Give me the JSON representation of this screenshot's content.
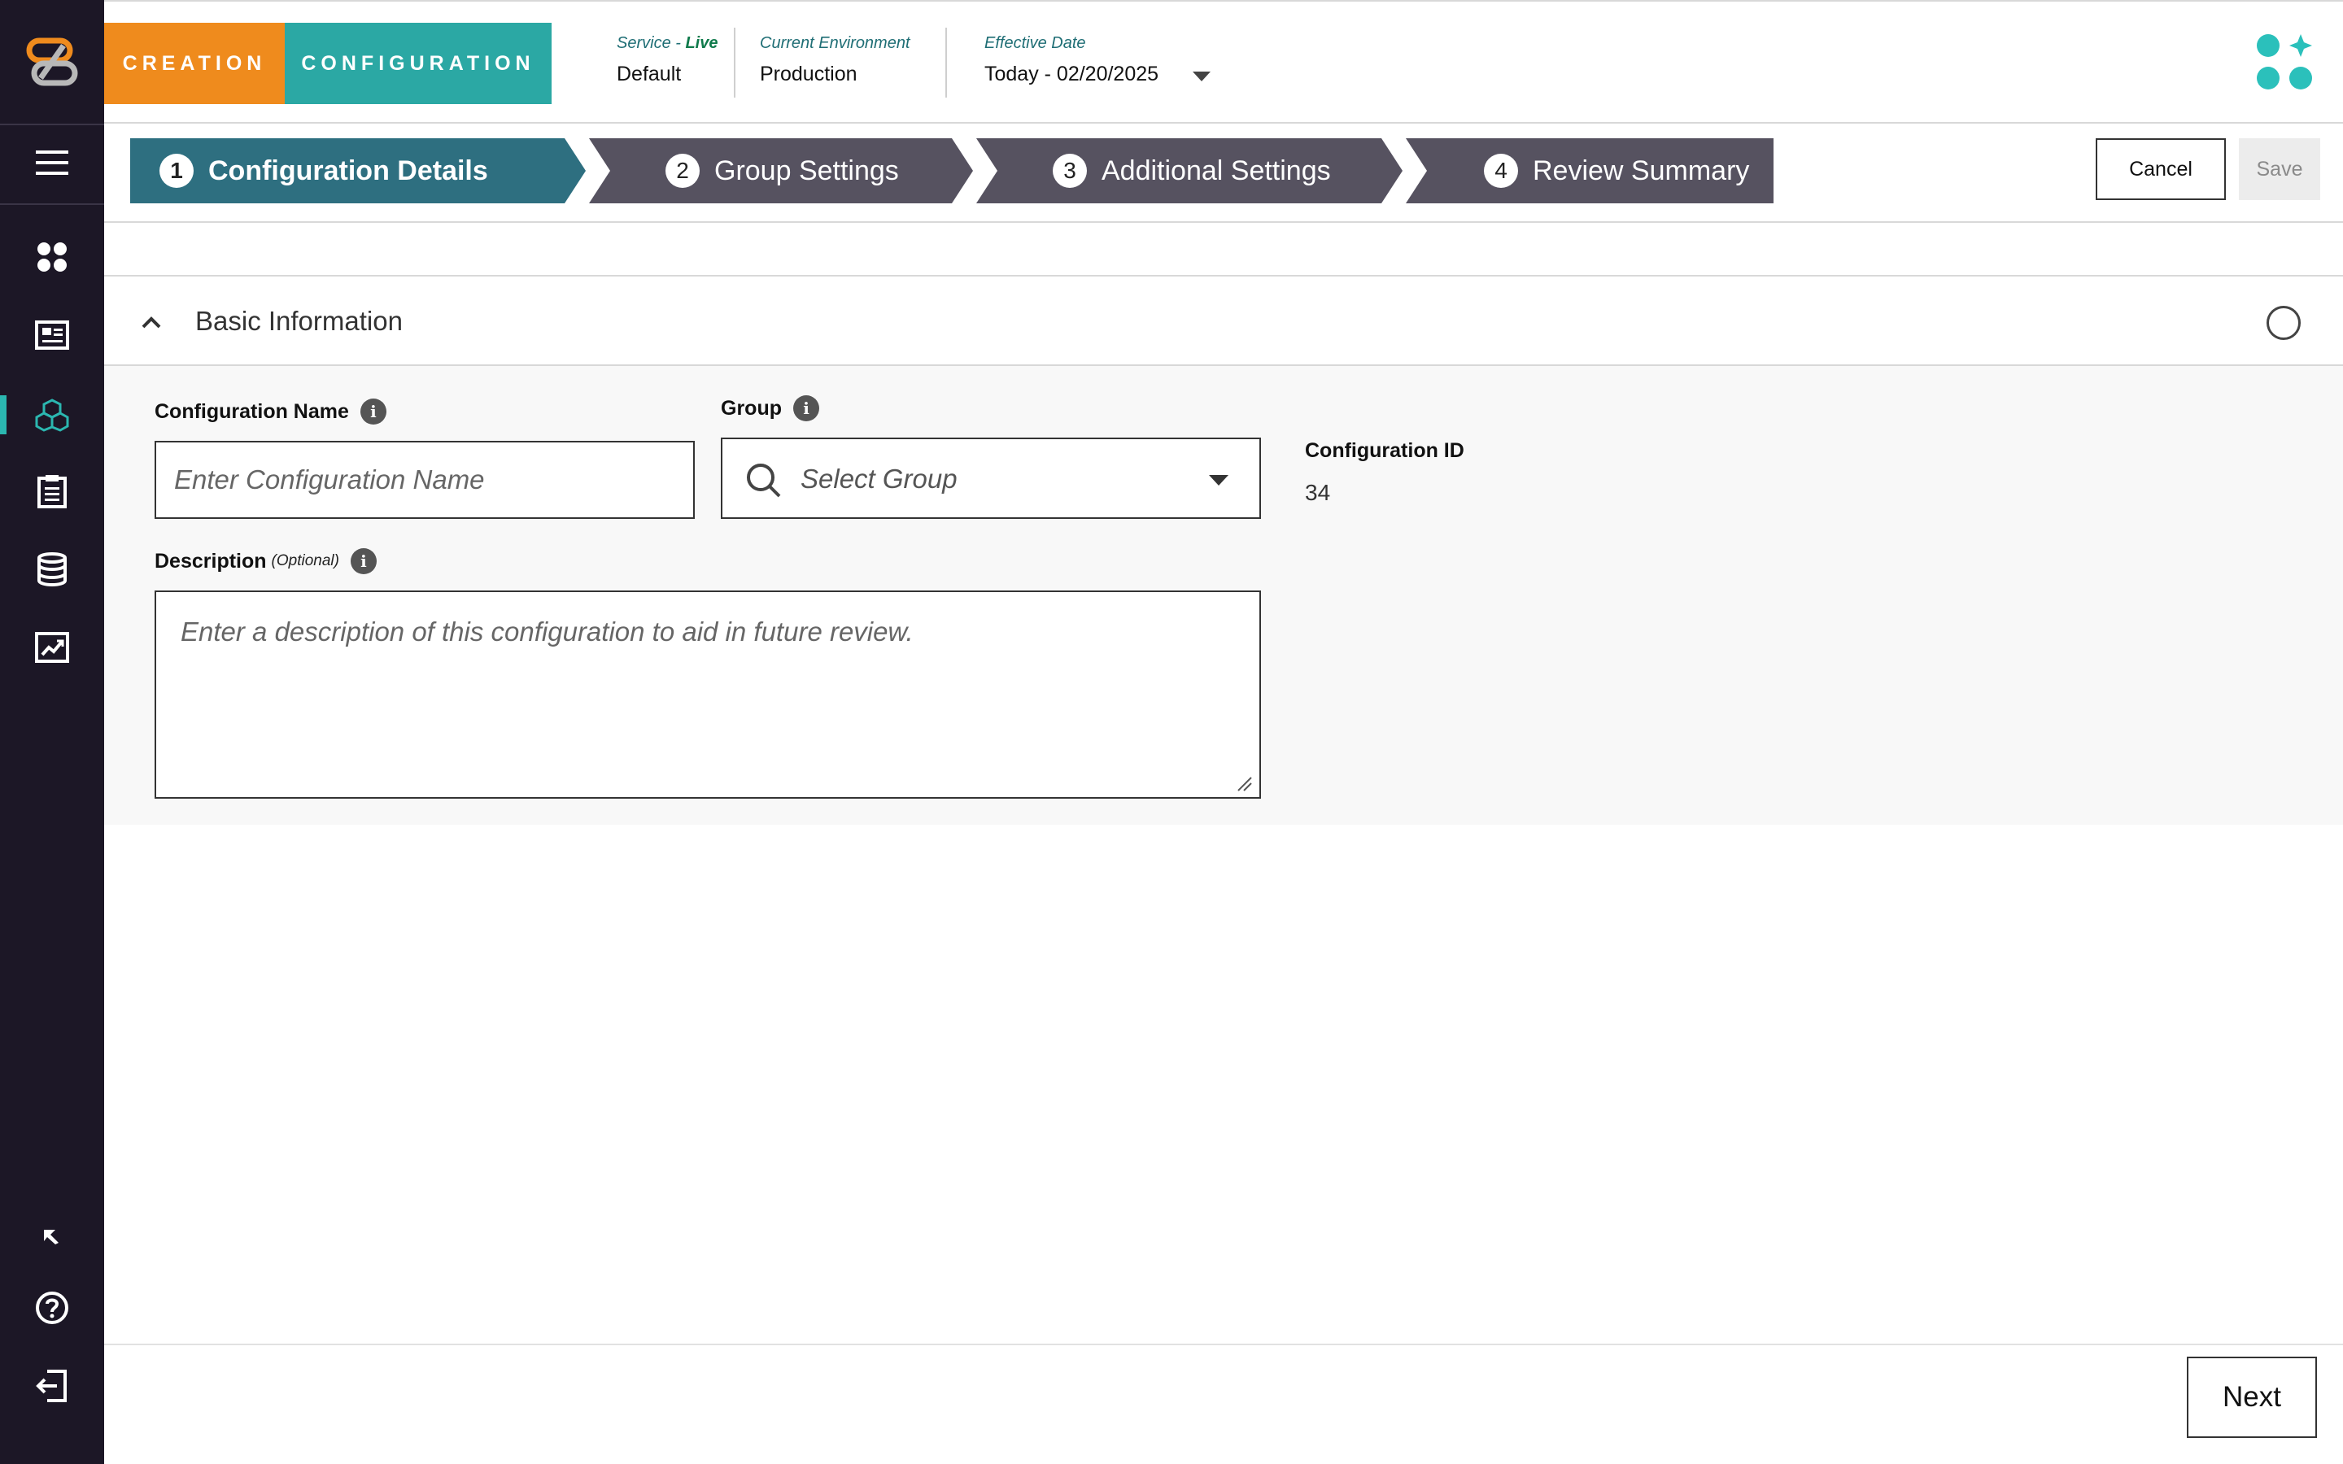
{
  "brand": {
    "creation": "CREATION",
    "configuration": "CONFIGURATION"
  },
  "header": {
    "service_label": "Service - ",
    "service_status": "Live",
    "service_value": "Default",
    "environment_label": "Current Environment",
    "environment_value": "Production",
    "date_label": "Effective Date",
    "date_value": "Today - 02/20/2025"
  },
  "steps": [
    {
      "num": "1",
      "label": "Configuration Details",
      "active": true
    },
    {
      "num": "2",
      "label": "Group Settings",
      "active": false
    },
    {
      "num": "3",
      "label": "Additional Settings",
      "active": false
    },
    {
      "num": "4",
      "label": "Review Summary",
      "active": false
    }
  ],
  "actions": {
    "cancel": "Cancel",
    "save": "Save",
    "next": "Next"
  },
  "section": {
    "title": "Basic Information"
  },
  "form": {
    "config_name_label": "Configuration Name",
    "config_name_placeholder": "Enter Configuration Name",
    "group_label": "Group",
    "group_placeholder": "Select Group",
    "description_label": "Description",
    "description_optional": "(Optional)",
    "description_placeholder": "Enter a description of this configuration to aid in future review.",
    "config_id_label": "Configuration ID",
    "config_id_value": "34"
  },
  "sidebar": {
    "icons": [
      "menu-icon",
      "dashboard-icon",
      "news-icon",
      "cubes-icon",
      "clipboard-icon",
      "database-icon",
      "chart-icon",
      "collapse-sidebar-icon",
      "help-icon",
      "logout-icon"
    ],
    "active": "cubes-icon"
  },
  "colors": {
    "sidebar": "#1c1726",
    "creation": "#ef8b1d",
    "configuration": "#2ba8a4",
    "step_active": "#2e6f80",
    "step_inactive": "#565260",
    "accent": "#2bb7b0"
  }
}
